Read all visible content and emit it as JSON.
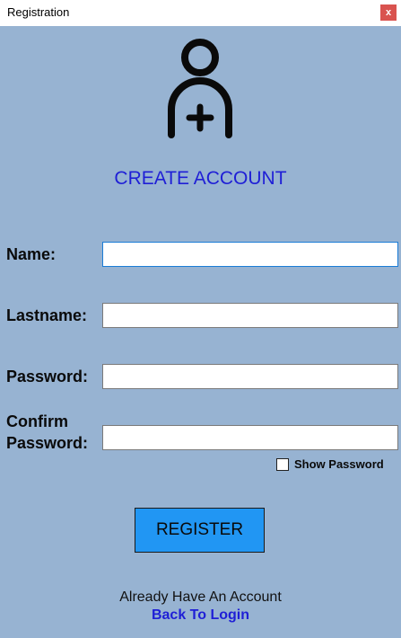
{
  "window": {
    "title": "Registration",
    "close_label": "x"
  },
  "header": {
    "icon": "add-user-icon",
    "title": "CREATE ACCOUNT"
  },
  "form": {
    "name_label": "Name:",
    "lastname_label": "Lastname:",
    "password_label": "Password:",
    "confirm_label_line1": "Confirm",
    "confirm_label_line2": "Password:",
    "name_value": "",
    "lastname_value": "",
    "password_value": "",
    "confirm_value": "",
    "show_password_label": "Show Password",
    "show_password_checked": false,
    "register_label": "REGISTER"
  },
  "footer": {
    "already_text": "Already Have An Account",
    "back_link": "Back To Login"
  },
  "colors": {
    "background": "#97b3d2",
    "heading": "#1f1fd6",
    "button": "#2196f3",
    "link": "#1f1fd6"
  }
}
